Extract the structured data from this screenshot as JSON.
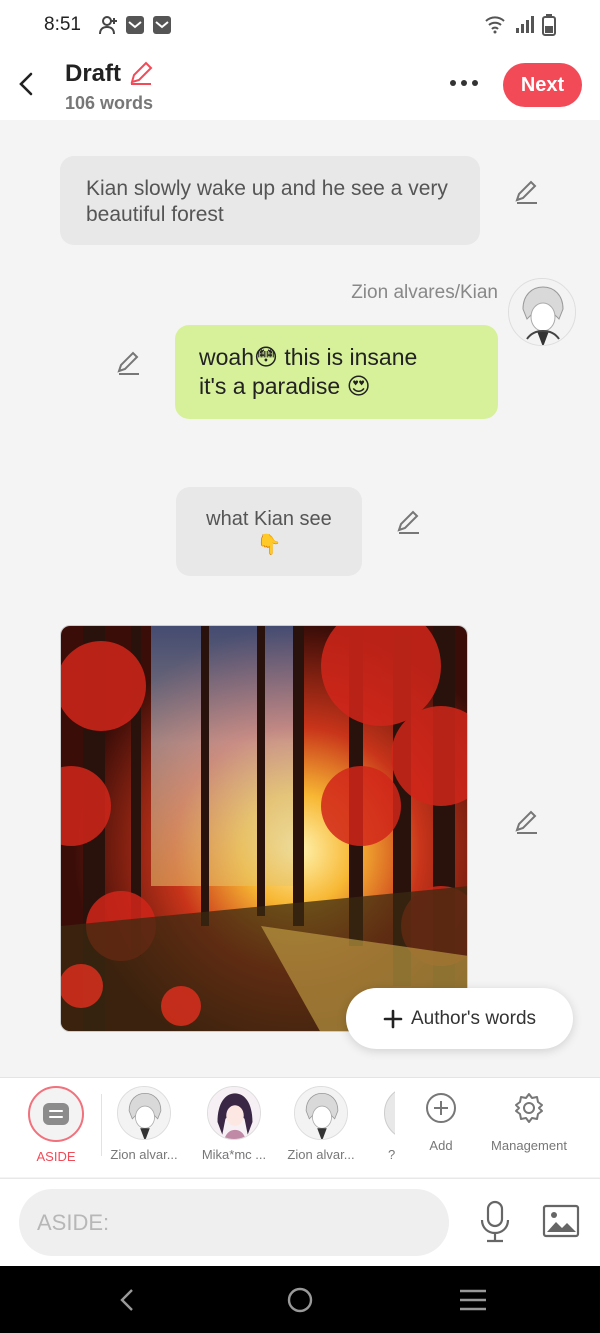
{
  "status_bar": {
    "time": "8:51"
  },
  "header": {
    "title": "Draft",
    "word_count": "106 words",
    "next_label": "Next"
  },
  "messages": {
    "narration_1": "Kian slowly wake up and he see a very beautiful forest",
    "sender_name": "Zion alvares/Kian",
    "speech_line_1": "woah😳 this is insane",
    "speech_line_2": "it's a paradise 😍",
    "narration_2_line_1": "what Kian see",
    "narration_2_line_2": "👇"
  },
  "authors_words_button": "Author's words",
  "characters": [
    {
      "label": "ASIDE",
      "active": true
    },
    {
      "label": "Zion alvar..."
    },
    {
      "label": "Mika*mc ..."
    },
    {
      "label": "Zion alvar..."
    },
    {
      "label": "?"
    }
  ],
  "add_label": "Add",
  "management_label": "Management",
  "input": {
    "placeholder": "ASIDE:"
  },
  "colors": {
    "accent": "#f34a57",
    "speech_bubble": "#d7f19b",
    "narration_bubble": "#e8e8e8"
  }
}
